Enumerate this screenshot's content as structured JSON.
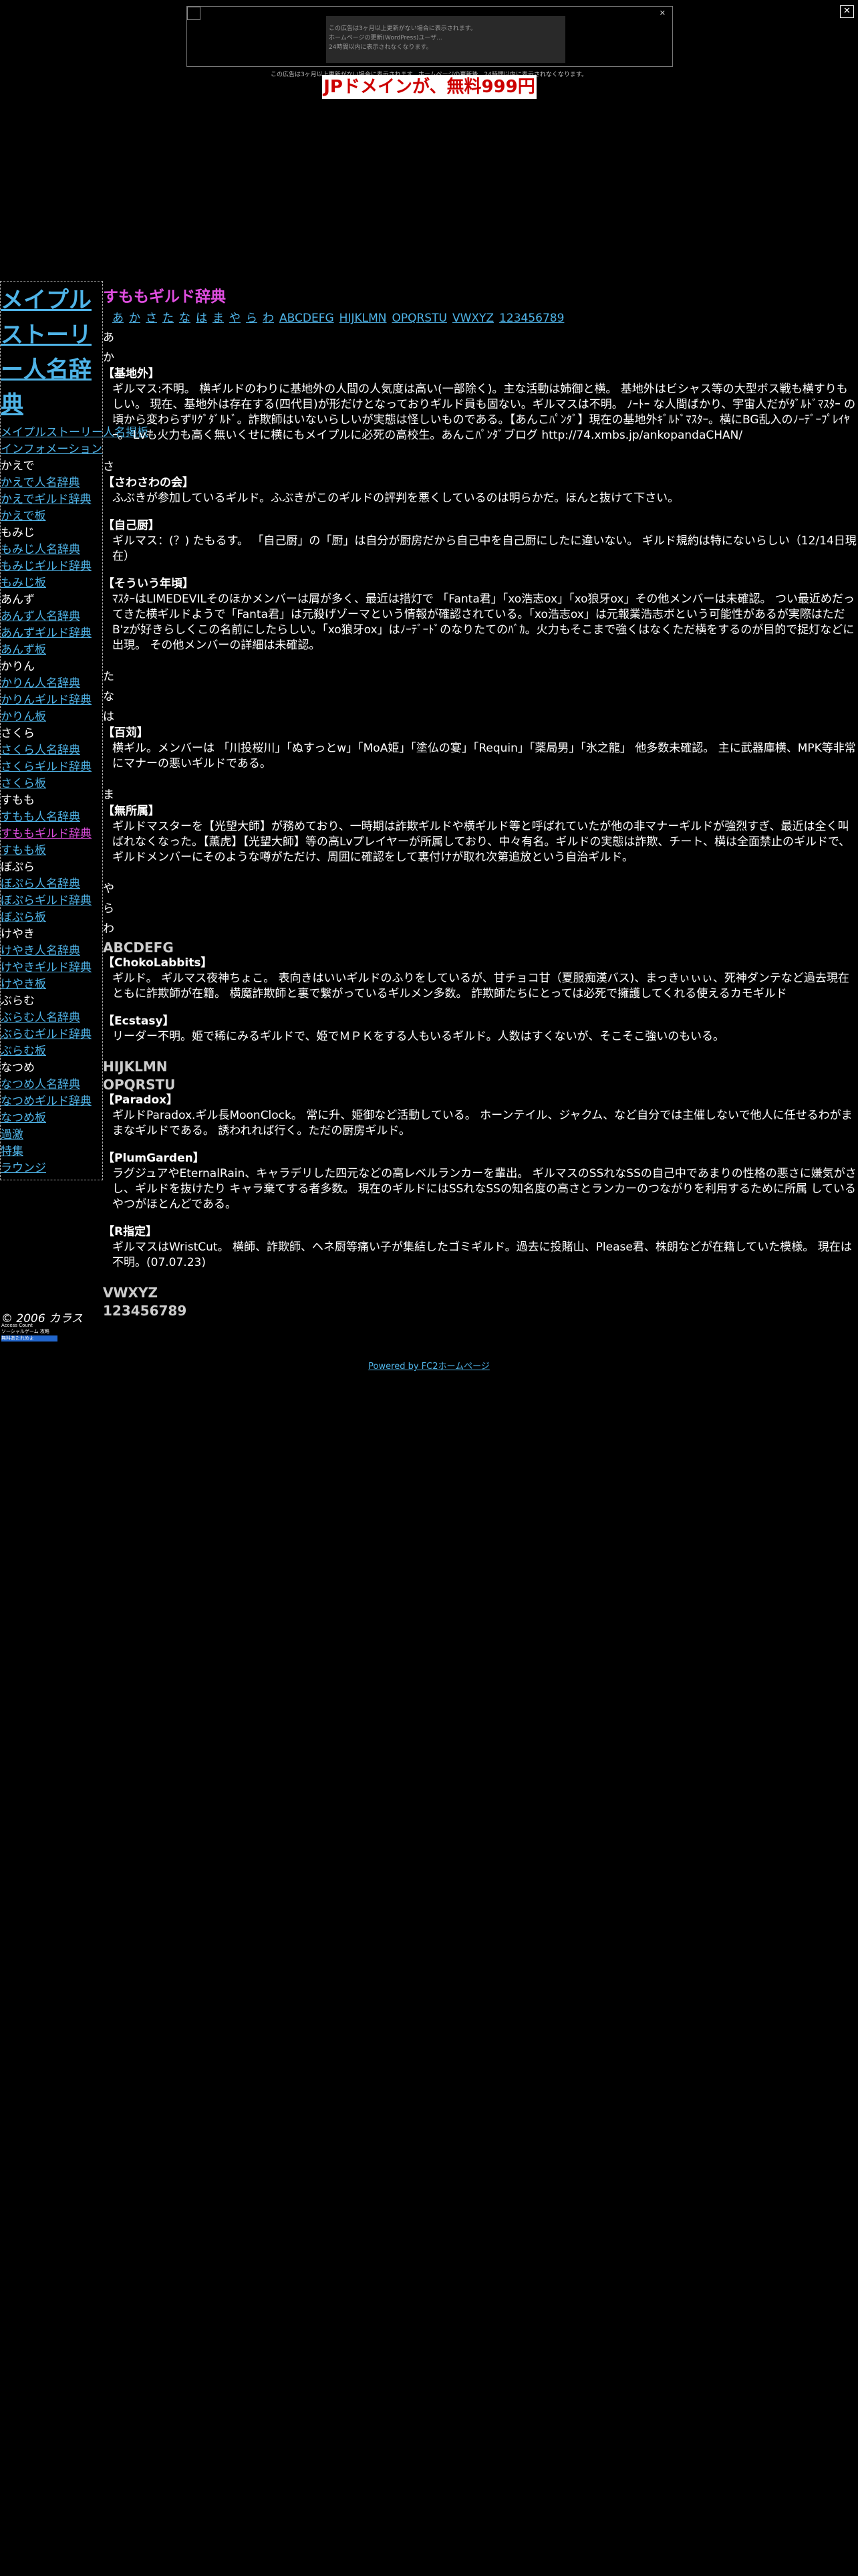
{
  "ad": {
    "close_label": "✕",
    "small_text": [
      "この広告は3ヶ月以上更新がない場合に表示されます。",
      "ホームページの更新(WordPress)ユーザ...",
      "24時間以内に表示されなくなります。"
    ],
    "x_label": "✕",
    "note": "この広告は3ヶ月以上更新がない場合に表示されます。ホームページの更新後、24時間以内に表示されなくなります。",
    "banner": "JPドメインが、無料999円"
  },
  "sidebar": {
    "title": "メイプルストーリー人名辞典",
    "items": [
      {
        "label": "メイプルストーリー人名掲板",
        "link": true
      },
      {
        "label": "インフォメーション",
        "link": true
      },
      {
        "label": "かえで",
        "link": false
      },
      {
        "label": "かえで人名辞典",
        "link": true
      },
      {
        "label": "かえでギルド辞典",
        "link": true
      },
      {
        "label": "かえで板",
        "link": true
      },
      {
        "label": "もみじ",
        "link": false
      },
      {
        "label": "もみじ人名辞典",
        "link": true
      },
      {
        "label": "もみじギルド辞典",
        "link": true
      },
      {
        "label": "もみじ板",
        "link": true
      },
      {
        "label": "あんず",
        "link": false
      },
      {
        "label": "あんず人名辞典",
        "link": true
      },
      {
        "label": "あんずギルド辞典",
        "link": true
      },
      {
        "label": "あんず板",
        "link": true
      },
      {
        "label": "かりん",
        "link": false
      },
      {
        "label": "かりん人名辞典",
        "link": true
      },
      {
        "label": "かりんギルド辞典",
        "link": true
      },
      {
        "label": "かりん板",
        "link": true
      },
      {
        "label": "さくら",
        "link": false
      },
      {
        "label": "さくら人名辞典",
        "link": true
      },
      {
        "label": "さくらギルド辞典",
        "link": true
      },
      {
        "label": "さくら板",
        "link": true
      },
      {
        "label": "すもも",
        "link": false
      },
      {
        "label": "すもも人名辞典",
        "link": true
      },
      {
        "label": "すももギルド辞典",
        "link": true,
        "active": true
      },
      {
        "label": "すもも板",
        "link": true
      },
      {
        "label": "ぼぷら",
        "link": false
      },
      {
        "label": "ぼぷら人名辞典",
        "link": true
      },
      {
        "label": "ぼぷらギルド辞典",
        "link": true
      },
      {
        "label": "ぼぷら板",
        "link": true
      },
      {
        "label": "けやき",
        "link": false
      },
      {
        "label": "けやき人名辞典",
        "link": true
      },
      {
        "label": "けやきギルド辞典",
        "link": true
      },
      {
        "label": "けやき板",
        "link": true
      },
      {
        "label": "ぶらむ",
        "link": false
      },
      {
        "label": "ぶらむ人名辞典",
        "link": true
      },
      {
        "label": "ぶらむギルド辞典",
        "link": true
      },
      {
        "label": "ぶらむ板",
        "link": true
      },
      {
        "label": "なつめ",
        "link": false
      },
      {
        "label": "なつめ人名辞典",
        "link": true
      },
      {
        "label": "なつめギルド辞典",
        "link": true
      },
      {
        "label": "なつめ板",
        "link": true
      },
      {
        "label": "過激",
        "link": true
      },
      {
        "label": "特集",
        "link": true
      },
      {
        "label": "ラウンジ",
        "link": true
      }
    ],
    "copyright": "© 2006 カラス",
    "badge_top": "Access Count",
    "badge_mid": "ソーシャルゲーム 攻略",
    "badge_bar": "無料あたれめよ"
  },
  "main": {
    "title": "すももギルド辞典",
    "index": [
      "あ",
      "か",
      "さ",
      "た",
      "な",
      "は",
      "ま",
      "や",
      "ら",
      "わ",
      "ABCDEFG",
      "HIJKLMN",
      "OPQRSTU",
      "VWXYZ",
      "123456789"
    ],
    "sections": [
      {
        "kana": "あ",
        "entries": []
      },
      {
        "kana": "か",
        "entries": [
          {
            "name": "【基地外】",
            "desc": "ギルマス:不明。 横ギルドのわりに基地外の人間の人気度は高い(一部除く)。主な活動は姉御と横。 基地外はビシャス等の大型ボス戦も横すりもしい。 現在、基地外は存在する(四代目)が形だけとなっておりギルド員も固ない。ギルマスは不明。 ﾉｰﾄｰ な人間ばかり、宇宙人だがﾀﾞﾙﾄﾞﾏｽﾀｰ の頃から変わらずﾘｸﾞﾀﾞﾙﾄﾞ。詐欺師はいないらしいが実態は怪しいものである。【あんこﾊﾟﾝﾀﾞ】現在の基地外ｷﾞﾙﾄﾞﾏｽﾀｰ。横にBG乱入のﾉｰﾃﾞｰﾌﾟﾚｲﾔｰ。 Lvも火力も高く無いくせに横にもメイプルに必死の高校生。あんこﾊﾟﾝﾀﾞブログ http://74.xmbs.jp/ankopandaCHAN/"
          }
        ]
      },
      {
        "kana": "さ",
        "entries": [
          {
            "name": "【さわさわの会】",
            "desc": "ふぶきが参加しているギルド。ふぶきがこのギルドの評判を悪くしているのは明らかだ。ほんと抜けて下さい。"
          },
          {
            "name": "【自己厨】",
            "desc": "ギルマス：(？) たもるす。 「自己厨」の「厨」は自分が厨房だから自己中を自己厨にしたに違いない。 ギルド規約は特にないらしい（12/14日現在）"
          },
          {
            "name": "【そういう年頃】",
            "desc": "ﾏｽﾀｰはLIMEDEVILそのほかメンバーは屑が多く、最近は措灯で 「Fanta君」「xo浩志ox」「xo狼牙ox」その他メンバーは未確認。 つい最近めだってきた横ギルドようで「Fanta君」は元殺げゾーマという情報が確認されている。「xo浩志ox」は元報業浩志ボという可能性があるが実際はただB'zが好きらしくこの名前にしたらしい。「xo狼牙ox」はﾉｰﾃﾞｰﾄﾞのなりたてのﾊﾞｶ。火力もそこまで強くはなくただ横をするのが目的で捉灯などに出現。 その他メンバーの詳細は未確認。"
          }
        ]
      },
      {
        "kana": "た",
        "entries": []
      },
      {
        "kana": "な",
        "entries": []
      },
      {
        "kana": "は",
        "entries": [
          {
            "name": "【百苅】",
            "desc": "横ギル。メンバーは 「川投桜川」「ぬすっとw」「MoA姫」「塗仏の宴」「Requin」「薬局男」「氷之龍」 他多数未確認。 主に武器庫横、MPK等非常にマナーの悪いギルドである。"
          }
        ]
      },
      {
        "kana": "ま",
        "entries": [
          {
            "name": "【無所属】",
            "desc": "ギルドマスターを【光望大師】が務めており、一時期は詐欺ギルドや横ギルド等と呼ばれていたが他の非マナーギルドが強烈すぎ、最近は全く叫ばれなくなった。【薫虎】【光望大師】等の高Lvプレイヤーが所属しており、中々有名。ギルドの実態は詐欺、チート、横は全面禁止のギルドで、ギルドメンバーにそのような噂がただけ、周囲に確認をして裏付けが取れ次第追放という自治ギルド。"
          }
        ]
      },
      {
        "kana": "や",
        "entries": []
      },
      {
        "kana": "ら",
        "entries": []
      },
      {
        "kana": "わ",
        "entries": []
      },
      {
        "alpha": "ABCDEFG",
        "entries": [
          {
            "name": "【ChokoLabbits】",
            "desc": "ギルド。 ギルマス夜神ちょこ。 表向きはいいギルドのふりをしているが、甘チョコ甘（夏服痴漢バス)、まっきぃぃぃ、死神ダンテなど過去現在ともに詐欺師が在籍。 横魔詐欺師と裏で繋がっているギルメン多数。 詐欺師たちにとっては必死で擁護してくれる使えるカモギルド"
          },
          {
            "name": "【Ecstasy】",
            "desc": "リーダー不明。姫で稀にみるギルドで、姫でＭＰＫをする人もいるギルド。人数はすくないが、そこそこ強いのもいる。"
          }
        ]
      },
      {
        "alpha": "HIJKLMN",
        "entries": []
      },
      {
        "alpha": "OPQRSTU",
        "entries": [
          {
            "name": "【Paradox】",
            "desc": "ギルドParadox.ギル長MoonClock。 常に升、姫御など活動している。 ホーンテイル、ジャクム、など自分では主催しないで他人に任せるわがままなギルドである。 誘われれば行く。ただの厨房ギルド。"
          },
          {
            "name": "【PlumGarden】",
            "desc": "ラグジュアやEternalRain、キャラデリした四元などの高レベルランカーを輩出。 ギルマスのSSれなSSの自己中であまりの性格の悪さに嫌気がさし、ギルドを抜けたり キャラ棄てする者多数。 現在のギルドにはSSれなSSの知名度の高さとランカーのつながりを利用するために所属 しているやつがほとんどである。"
          },
          {
            "name": "【R指定】",
            "desc": "ギルマスはWristCut。 横師、詐欺師、ヘネ厨等痛い子が集結したゴミギルド。過去に投賭山、Please君、株朗などが在籍していた模様。 現在は不明。(07.07.23)"
          }
        ]
      },
      {
        "alpha": "VWXYZ",
        "entries": []
      },
      {
        "alpha": "123456789",
        "entries": []
      }
    ]
  },
  "footer": {
    "link": "Powered by FC2ホームページ"
  }
}
